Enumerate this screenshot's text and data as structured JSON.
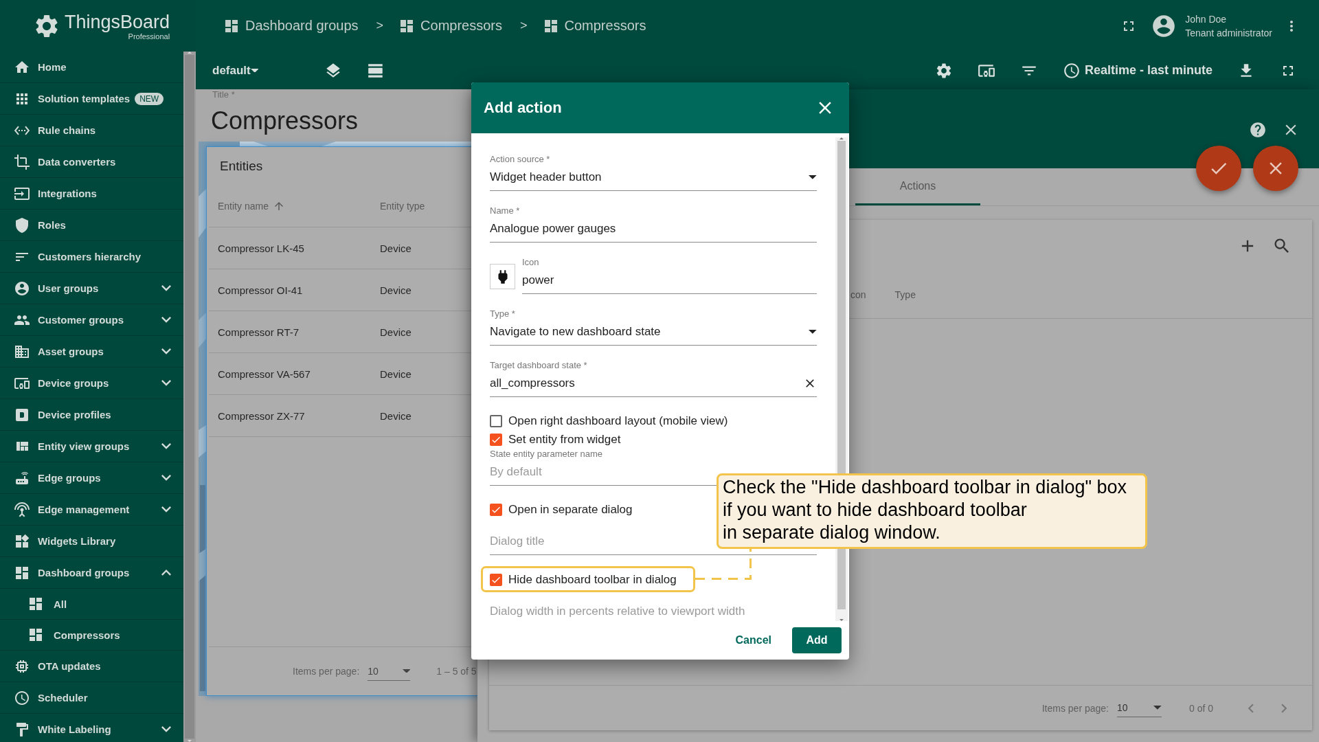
{
  "brand": {
    "name": "ThingsBoard",
    "edition": "Professional"
  },
  "sidebar": {
    "items": [
      {
        "label": "Home",
        "kind": "link"
      },
      {
        "label": "Solution templates",
        "kind": "link",
        "badge": "NEW"
      },
      {
        "label": "Rule chains",
        "kind": "link"
      },
      {
        "label": "Data converters",
        "kind": "link"
      },
      {
        "label": "Integrations",
        "kind": "link"
      },
      {
        "label": "Roles",
        "kind": "link"
      },
      {
        "label": "Customers hierarchy",
        "kind": "link"
      },
      {
        "label": "User groups",
        "kind": "group",
        "expanded": false
      },
      {
        "label": "Customer groups",
        "kind": "group",
        "expanded": false
      },
      {
        "label": "Asset groups",
        "kind": "group",
        "expanded": false
      },
      {
        "label": "Device groups",
        "kind": "group",
        "expanded": false
      },
      {
        "label": "Device profiles",
        "kind": "link"
      },
      {
        "label": "Entity view groups",
        "kind": "group",
        "expanded": false
      },
      {
        "label": "Edge groups",
        "kind": "group",
        "expanded": false
      },
      {
        "label": "Edge management",
        "kind": "group",
        "expanded": false
      },
      {
        "label": "Widgets Library",
        "kind": "link"
      },
      {
        "label": "Dashboard groups",
        "kind": "group",
        "expanded": true,
        "children": [
          {
            "label": "All"
          },
          {
            "label": "Compressors"
          }
        ]
      },
      {
        "label": "OTA updates",
        "kind": "link"
      },
      {
        "label": "Scheduler",
        "kind": "link"
      },
      {
        "label": "White Labeling",
        "kind": "group",
        "expanded": false
      }
    ]
  },
  "header": {
    "breadcrumbs": [
      {
        "label": "Dashboard groups",
        "separator": ">"
      },
      {
        "label": "Compressors",
        "separator": ">"
      },
      {
        "label": "Compressors"
      }
    ],
    "user": {
      "name": "John Doe",
      "role": "Tenant administrator"
    }
  },
  "toolbar": {
    "state": "default",
    "timewindow": "Realtime - last minute"
  },
  "dashboard": {
    "title_label": "Title *",
    "title": "Compressors",
    "widget": {
      "title": "Entities",
      "columns": [
        {
          "label": "Entity name",
          "sorted": true
        },
        {
          "label": "Entity type",
          "sorted": false
        }
      ],
      "rows": [
        [
          "Compressor LK-45",
          "Device"
        ],
        [
          "Compressor OI-41",
          "Device"
        ],
        [
          "Compressor RT-7",
          "Device"
        ],
        [
          "Compressor VA-567",
          "Device"
        ],
        [
          "Compressor ZX-77",
          "Device"
        ]
      ],
      "paginator": {
        "label": "Items per page:",
        "page_size": "10",
        "range": "1 – 5 of 5"
      }
    }
  },
  "editor": {
    "tabs": [
      {
        "label": "Actions",
        "selected": true
      }
    ],
    "columns": [
      "con",
      "Type"
    ],
    "paginator": {
      "label": "Items per page:",
      "page_size": "10",
      "range": "0 of 0"
    }
  },
  "dialog": {
    "title": "Add action",
    "fields": [
      {
        "kind": "select",
        "label": "Action source *",
        "value": "Widget header button"
      },
      {
        "kind": "text",
        "label": "Name *",
        "value": "Analogue power gauges"
      },
      {
        "kind": "icon",
        "label": "Icon",
        "value": "power"
      },
      {
        "kind": "select",
        "label": "Type *",
        "value": "Navigate to new dashboard state"
      },
      {
        "kind": "clearable",
        "label": "Target dashboard state *",
        "value": "all_compressors"
      },
      {
        "kind": "checkbox",
        "label": "Open right dashboard layout (mobile view)",
        "checked": false
      },
      {
        "kind": "checkbox",
        "label": "Set entity from widget",
        "checked": true
      },
      {
        "kind": "text",
        "label": "State entity parameter name",
        "placeholder": "By default"
      },
      {
        "kind": "checkbox",
        "label": "Open in separate dialog",
        "checked": true
      },
      {
        "kind": "text",
        "placeholder": "Dialog title"
      },
      {
        "kind": "checkbox",
        "label": "Hide dashboard toolbar in dialog",
        "checked": true,
        "highlighted": true
      },
      {
        "kind": "text",
        "placeholder": "Dialog width in percents relative to viewport width"
      }
    ],
    "buttons": [
      {
        "label": "Cancel",
        "kind": "text"
      },
      {
        "label": "Add",
        "kind": "primary"
      }
    ]
  },
  "note": {
    "text": "Check the \"Hide dashboard toolbar in dialog\" box\nif you want to hide dashboard toolbar\nin separate dialog window."
  }
}
